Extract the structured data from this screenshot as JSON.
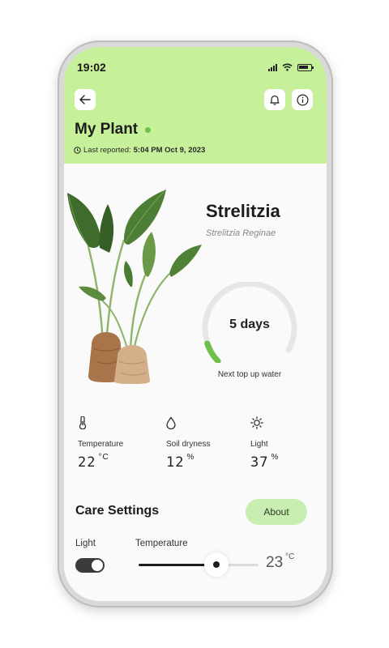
{
  "status": {
    "time": "19:02"
  },
  "header": {
    "title": "My Plant",
    "reported_prefix": "Last reported:",
    "reported_time": "5:04 PM Oct 9, 2023"
  },
  "plant": {
    "name": "Strelitzia",
    "latin_name": "Strelitzia Reginae"
  },
  "watering": {
    "value": "5 days",
    "label": "Next top up water",
    "progress_fraction": 0.1
  },
  "metrics": [
    {
      "label": "Temperature",
      "value": "22",
      "unit": "°C",
      "icon": "thermometer-icon"
    },
    {
      "label": "Soil dryness",
      "value": "12",
      "unit": "%",
      "icon": "droplet-icon"
    },
    {
      "label": "Light",
      "value": "37",
      "unit": "%",
      "icon": "sun-icon"
    }
  ],
  "care": {
    "title": "Care Settings",
    "about_label": "About",
    "light_label": "Light",
    "light_on": true,
    "temperature_label": "Temperature",
    "temperature_value": "23",
    "temperature_unit": "°C",
    "temperature_fraction": 0.65
  },
  "colors": {
    "header_bg": "#c6f19a",
    "accent_green": "#6fbf4a",
    "about_bg": "#c9eeb2"
  }
}
